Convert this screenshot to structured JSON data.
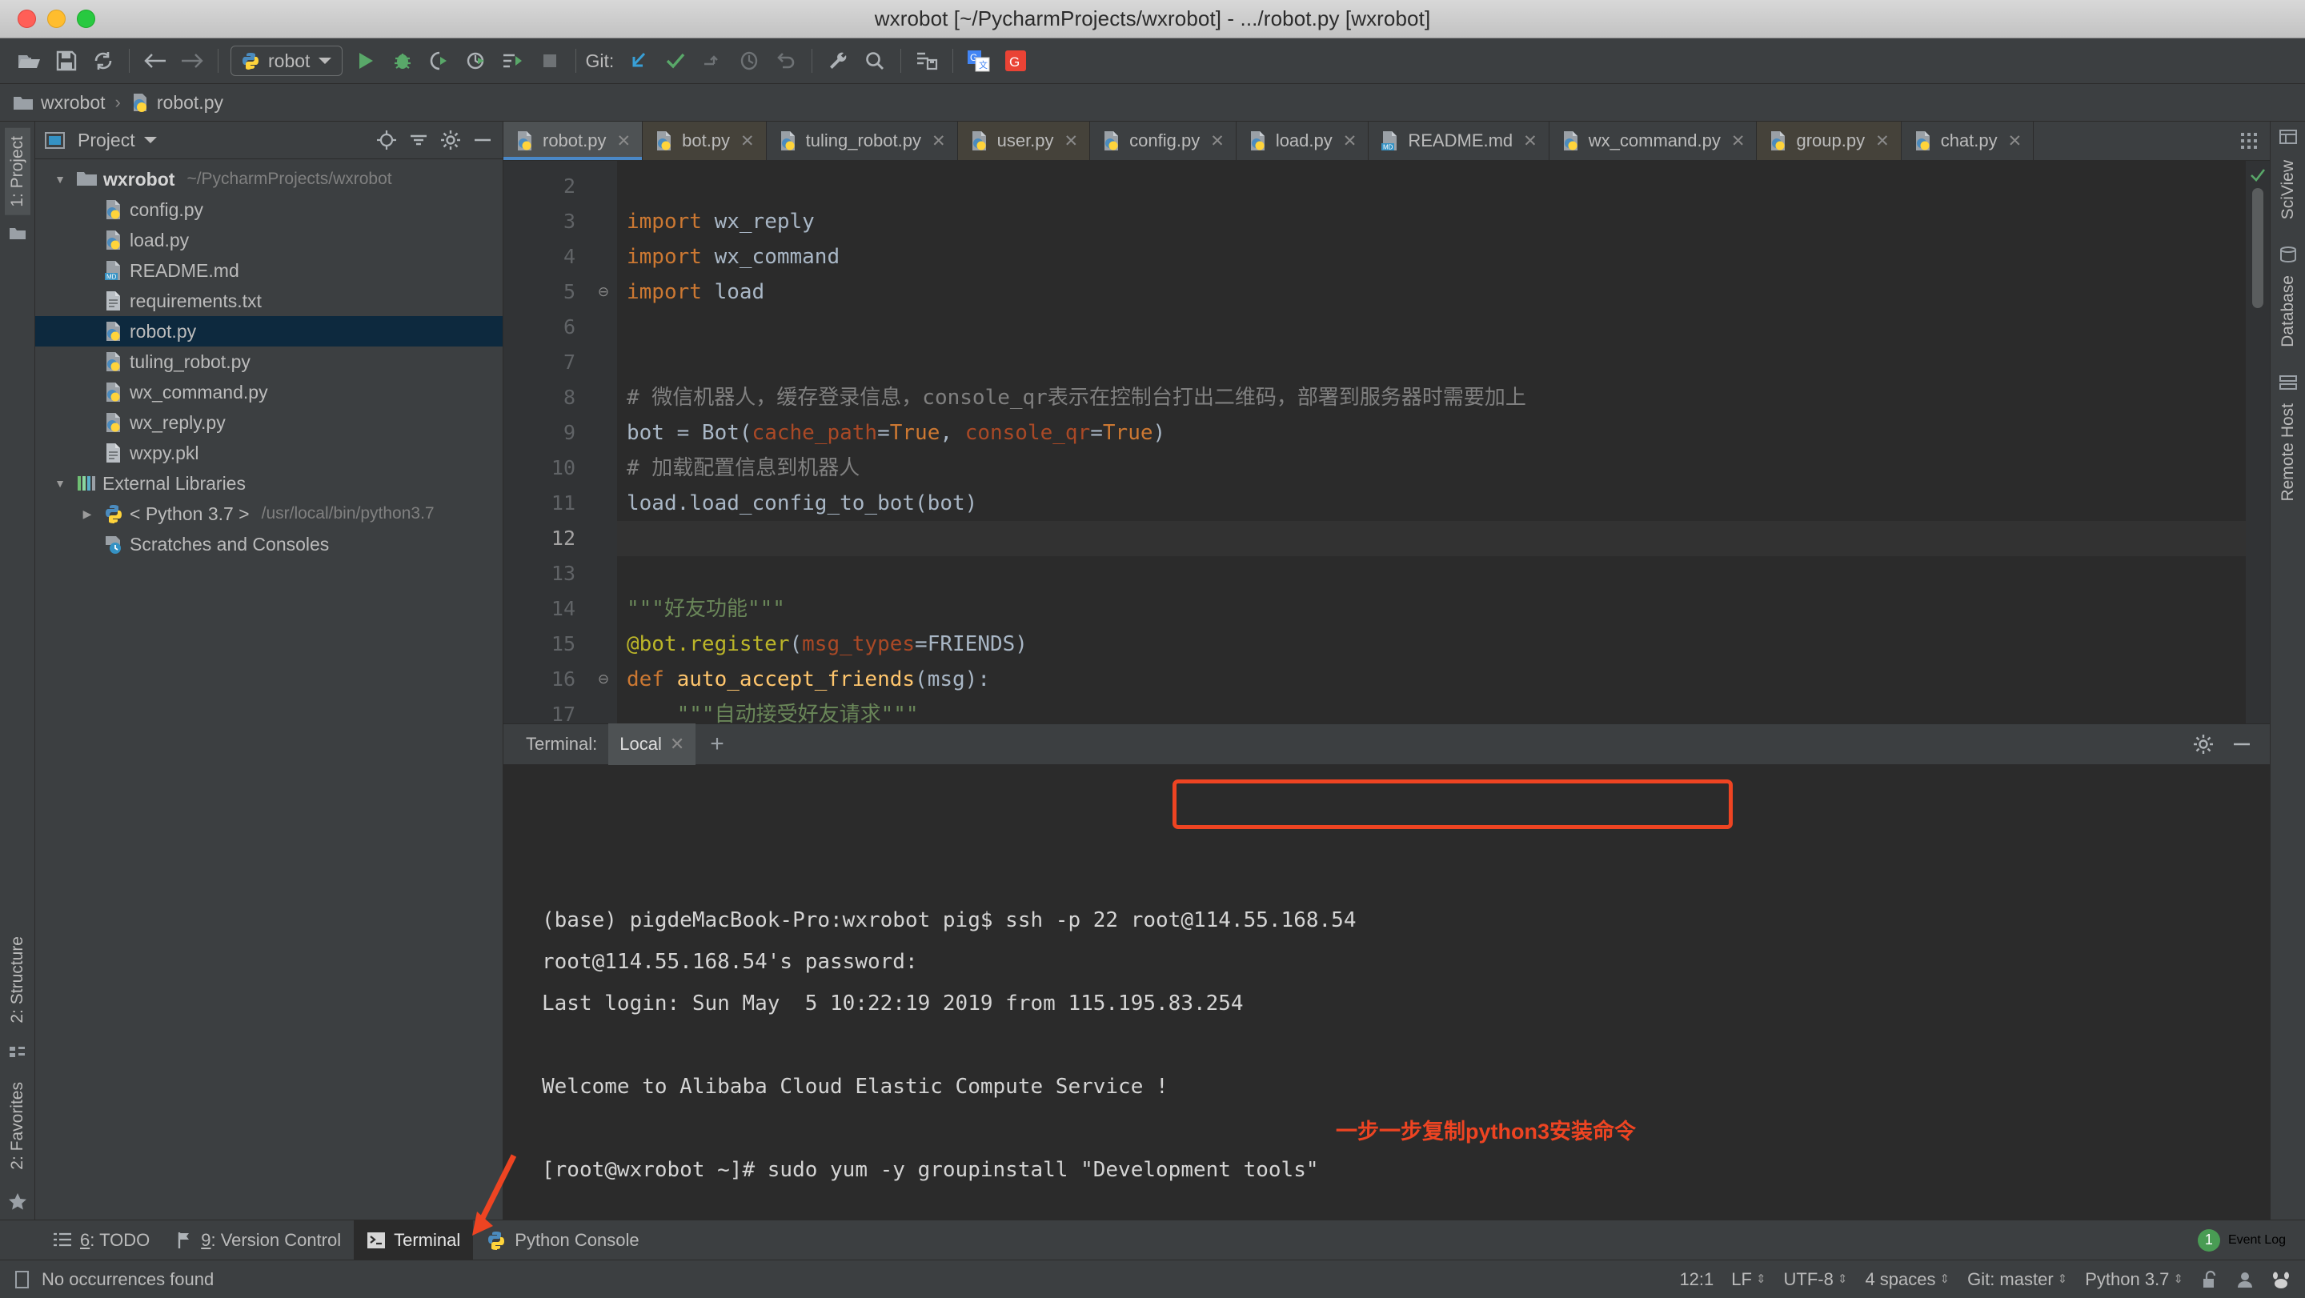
{
  "window": {
    "title": "wxrobot [~/PycharmProjects/wxrobot] - .../robot.py [wxrobot]"
  },
  "toolbar": {
    "open_icon": "open-folder-icon",
    "save_icon": "save-icon",
    "sync_icon": "sync-icon",
    "back_icon": "back-arrow-icon",
    "forward_icon": "forward-arrow-icon",
    "run_config_label": "robot",
    "run_config_icon": "python-file-icon",
    "dropdown_icon": "chevron-down-icon",
    "run_icon": "run-icon",
    "debug_icon": "debug-icon",
    "run_coverage_icon": "run-coverage-icon",
    "profile_icon": "profile-icon",
    "run_with_params_icon": "run-with-parameters-icon",
    "stop_icon": "stop-icon",
    "git_label": "Git:",
    "git_update_icon": "git-update-project-icon",
    "git_commit_icon": "git-commit-icon",
    "git_push_icon": "git-push-icon",
    "git_history_icon": "git-history-icon",
    "git_revert_icon": "git-revert-icon",
    "settings_icon": "wrench-settings-icon",
    "search_icon": "search-icon",
    "deploy_icon": "deploy-icon",
    "translate_icon": "google-translate-icon",
    "google_icon": "google-search-icon"
  },
  "breadcrumb": {
    "folder_icon": "folder-icon",
    "project": "wxrobot",
    "separator": "›",
    "file_icon": "python-file-icon",
    "file": "robot.py"
  },
  "left_strip": {
    "project_tab": "1: Project",
    "structure_tab": "2: Structure",
    "favorites_tab": "2: Favorites",
    "star_icon": "star-icon"
  },
  "right_strip": {
    "sciview_tab": "SciView",
    "database_tab": "Database",
    "remote_host_tab": "Remote Host"
  },
  "project_panel": {
    "header_icon": "project-view-icon",
    "title": "Project",
    "dropdown_icon": "chevron-down-icon",
    "target_icon": "scroll-from-source-icon",
    "collapse_icon": "collapse-all-icon",
    "gear_icon": "gear-icon",
    "hide_icon": "hide-icon",
    "tree": [
      {
        "label": "wxrobot",
        "path": "~/PycharmProjects/wxrobot",
        "icon": "folder-icon",
        "twist": "▼",
        "indent": 0,
        "bold": true,
        "selected": false
      },
      {
        "label": "config.py",
        "path": "",
        "icon": "python-file-icon",
        "twist": "",
        "indent": 1,
        "bold": false,
        "selected": false
      },
      {
        "label": "load.py",
        "path": "",
        "icon": "python-file-icon",
        "twist": "",
        "indent": 1,
        "bold": false,
        "selected": false
      },
      {
        "label": "README.md",
        "path": "",
        "icon": "markdown-file-icon",
        "twist": "",
        "indent": 1,
        "bold": false,
        "selected": false
      },
      {
        "label": "requirements.txt",
        "path": "",
        "icon": "text-file-icon",
        "twist": "",
        "indent": 1,
        "bold": false,
        "selected": false
      },
      {
        "label": "robot.py",
        "path": "",
        "icon": "python-file-icon",
        "twist": "",
        "indent": 1,
        "bold": false,
        "selected": true
      },
      {
        "label": "tuling_robot.py",
        "path": "",
        "icon": "python-file-icon",
        "twist": "",
        "indent": 1,
        "bold": false,
        "selected": false
      },
      {
        "label": "wx_command.py",
        "path": "",
        "icon": "python-file-icon",
        "twist": "",
        "indent": 1,
        "bold": false,
        "selected": false
      },
      {
        "label": "wx_reply.py",
        "path": "",
        "icon": "python-file-icon",
        "twist": "",
        "indent": 1,
        "bold": false,
        "selected": false
      },
      {
        "label": "wxpy.pkl",
        "path": "",
        "icon": "text-file-icon",
        "twist": "",
        "indent": 1,
        "bold": false,
        "selected": false
      },
      {
        "label": "External Libraries",
        "path": "",
        "icon": "libraries-icon",
        "twist": "▼",
        "indent": 0,
        "bold": false,
        "selected": false
      },
      {
        "label": "< Python 3.7 >",
        "path": "/usr/local/bin/python3.7",
        "icon": "python-icon",
        "twist": "▶",
        "indent": 1,
        "bold": false,
        "selected": false
      },
      {
        "label": "Scratches and Consoles",
        "path": "",
        "icon": "scratches-icon",
        "twist": "",
        "indent": 1,
        "bold": false,
        "selected": false
      }
    ]
  },
  "editor_tabs": [
    {
      "label": "robot.py",
      "icon": "python-file-icon",
      "active": true,
      "modified": false
    },
    {
      "label": "bot.py",
      "icon": "python-file-icon",
      "active": false,
      "modified": true
    },
    {
      "label": "tuling_robot.py",
      "icon": "python-file-icon",
      "active": false,
      "modified": false
    },
    {
      "label": "user.py",
      "icon": "python-file-icon",
      "active": false,
      "modified": true
    },
    {
      "label": "config.py",
      "icon": "python-file-icon",
      "active": false,
      "modified": false
    },
    {
      "label": "load.py",
      "icon": "python-file-icon",
      "active": false,
      "modified": false
    },
    {
      "label": "README.md",
      "icon": "markdown-file-icon",
      "active": false,
      "modified": false
    },
    {
      "label": "wx_command.py",
      "icon": "python-file-icon",
      "active": false,
      "modified": false
    },
    {
      "label": "group.py",
      "icon": "python-file-icon",
      "active": false,
      "modified": true
    },
    {
      "label": "chat.py",
      "icon": "python-file-icon",
      "active": false,
      "modified": false
    }
  ],
  "editor": {
    "first_line_number": 2,
    "lines": [
      {
        "n": 2,
        "html": "",
        "fold": "",
        "current": false
      },
      {
        "n": 3,
        "html": "<span class='kw'>import</span> wx_reply",
        "fold": "",
        "current": false
      },
      {
        "n": 4,
        "html": "<span class='kw'>import</span> wx_command",
        "fold": "",
        "current": false
      },
      {
        "n": 5,
        "html": "<span class='kw'>import</span> load",
        "fold": "⊖",
        "current": false
      },
      {
        "n": 6,
        "html": "",
        "fold": "",
        "current": false
      },
      {
        "n": 7,
        "html": "",
        "fold": "",
        "current": false
      },
      {
        "n": 8,
        "html": "<span class='cmt'># 微信机器人，缓存登录信息，console_qr表示在控制台打出二维码，部署到服务器时需要加上</span>",
        "fold": "",
        "current": false
      },
      {
        "n": 9,
        "html": "bot = Bot(<span class='param'>cache_path</span>=<span class='kw'>True</span>, <span class='param'>console_qr</span>=<span class='kw'>True</span>)",
        "fold": "",
        "current": false
      },
      {
        "n": 10,
        "html": "<span class='cmt'># 加载配置信息到机器人</span>",
        "fold": "",
        "current": false
      },
      {
        "n": 11,
        "html": "load.load_config_to_bot(bot)",
        "fold": "",
        "current": false
      },
      {
        "n": 12,
        "html": "",
        "fold": "",
        "current": true
      },
      {
        "n": 13,
        "html": "",
        "fold": "",
        "current": false
      },
      {
        "n": 14,
        "html": "<span class='str'>\"\"\"好友功能\"\"\"</span>",
        "fold": "",
        "current": false
      },
      {
        "n": 15,
        "html": "<span class='deco'>@bot.register</span>(<span class='param'>msg_types</span>=FRIENDS)",
        "fold": "",
        "current": false
      },
      {
        "n": 16,
        "html": "<span class='kw'>def</span> <span class='fn'>auto_accept_friends</span>(msg):",
        "fold": "⊖",
        "current": false
      },
      {
        "n": 17,
        "html": "    <span class='str'>\"\"\"自动接受好友请求\"\"\"</span>",
        "fold": "",
        "current": false
      }
    ]
  },
  "terminal": {
    "label": "Terminal:",
    "tab_label": "Local",
    "close_icon": "close-icon",
    "add_icon": "plus-icon",
    "gear_icon": "gear-icon",
    "minimize_icon": "minimize-icon",
    "lines": [
      "(base) pigdeMacBook-Pro:wxrobot pig$ ssh -p 22 root@114.55.168.54",
      "root@114.55.168.54's password:",
      "Last login: Sun May  5 10:22:19 2019 from 115.195.83.254",
      "",
      "Welcome to Alibaba Cloud Elastic Compute Service !",
      "",
      "[root@wxrobot ~]# sudo yum -y groupinstall \"Development tools\""
    ],
    "highlighted_command": "ssh -p 22 root@114.55.168.54",
    "annotation": "一步一步复制python3安装命令",
    "annotation_color": "#ee4422"
  },
  "bottom_tabs": [
    {
      "label": "6: TODO",
      "underline": "6",
      "rest": ": TODO",
      "icon": "todo-icon",
      "active": false
    },
    {
      "label": "9: Version Control",
      "underline": "9",
      "rest": ": Version Control",
      "icon": "version-control-icon",
      "active": false
    },
    {
      "label": "Terminal",
      "underline": "",
      "rest": "Terminal",
      "icon": "terminal-icon",
      "active": true
    },
    {
      "label": "Python Console",
      "underline": "",
      "rest": "Python Console",
      "icon": "python-icon",
      "active": false
    }
  ],
  "event_log": {
    "count": "1",
    "label": "Event Log"
  },
  "statusbar": {
    "message_icon": "message-icon",
    "message": "No occurrences found",
    "caret": "12:1",
    "line_separator": "LF",
    "encoding": "UTF-8",
    "indent": "4 spaces",
    "git_branch": "Git: master",
    "interpreter": "Python 3.7",
    "lock_icon": "unlocked-icon",
    "inspector_icon": "inspector-icon",
    "baidu_icon": "baidu-icon"
  }
}
